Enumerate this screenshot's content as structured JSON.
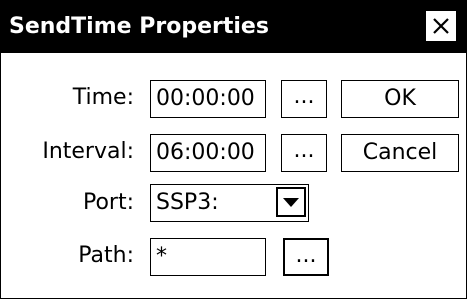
{
  "window": {
    "title": "SendTime Properties",
    "close_icon": "close-icon"
  },
  "form": {
    "time": {
      "label": "Time:",
      "value": "00:00:00",
      "picker_label": "..."
    },
    "interval": {
      "label": "Interval:",
      "value": "06:00:00",
      "picker_label": "..."
    },
    "port": {
      "label": "Port:",
      "selected": "SSP3:",
      "dropdown_icon": "dropdown-arrow-icon"
    },
    "path": {
      "label": "Path:",
      "value": "*",
      "browse_label": "..."
    }
  },
  "buttons": {
    "ok_label": "OK",
    "cancel_label": "Cancel"
  },
  "colors": {
    "titlebar_background": "#000000",
    "titlebar_text": "#ffffff",
    "window_background": "#ffffff"
  }
}
